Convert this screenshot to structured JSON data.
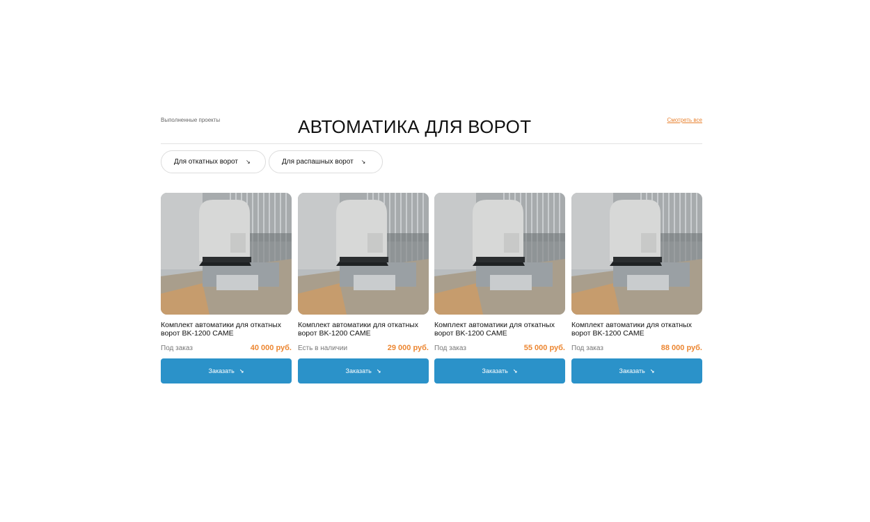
{
  "section": {
    "eyebrow": "Выполненные проекты",
    "title": "АВТОМАТИКА ДЛЯ ВОРОТ",
    "see_all": "Смотреть все"
  },
  "filters": [
    {
      "label": "Для откатных ворот",
      "icon": "chevron-down-right-icon"
    },
    {
      "label": "Для распашных ворот",
      "icon": "chevron-down-right-icon"
    }
  ],
  "products": [
    {
      "title": "Комплект автоматики для откатных ворот BK-1200 CAME",
      "status": "Под заказ",
      "price": "40 000 руб.",
      "button": "Заказать",
      "image": "sliding-gate-motor-photo"
    },
    {
      "title": "Комплект автоматики для откатных ворот BK-1200 CAME",
      "status": "Есть в наличии",
      "price": "29 000 руб.",
      "button": "Заказать",
      "image": "sliding-gate-motor-photo"
    },
    {
      "title": "Комплект автоматики для откатных ворот BK-1200 CAME",
      "status": "Под заказ",
      "price": "55 000 руб.",
      "button": "Заказать",
      "image": "sliding-gate-motor-photo"
    },
    {
      "title": "Комплект автоматики для откатных ворот BK-1200 CAME",
      "status": "Под заказ",
      "price": "88 000 руб.",
      "button": "Заказать",
      "image": "sliding-gate-motor-photo"
    }
  ],
  "colors": {
    "accent_orange": "#ec8631",
    "button_blue": "#2b92c9"
  }
}
